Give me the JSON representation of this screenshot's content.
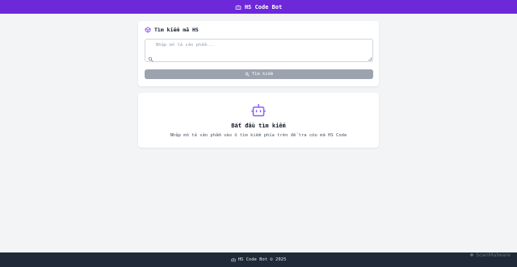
{
  "app": {
    "title": "HS Code Bot",
    "accent_color": "#6d28d9",
    "header_icon": "robot-icon"
  },
  "search": {
    "title": "Tìm kiếm mã HS",
    "title_icon": "package-icon",
    "placeholder": "Nhập mô tả sản phẩm...",
    "input_value": "",
    "button_label": "Tìm kiếm",
    "button_icon": "search-icon"
  },
  "result": {
    "icon": "robot-icon",
    "title": "Bắt đầu tìm kiếm",
    "subtitle": "Nhập mô tả sản phẩm vào ô tìm kiếm phía trên để tra cứu mã HS Code"
  },
  "footer": {
    "text": "HS Code Bot © 2025",
    "icon": "robot-icon"
  },
  "watermark": {
    "text": "ScanMalware"
  }
}
